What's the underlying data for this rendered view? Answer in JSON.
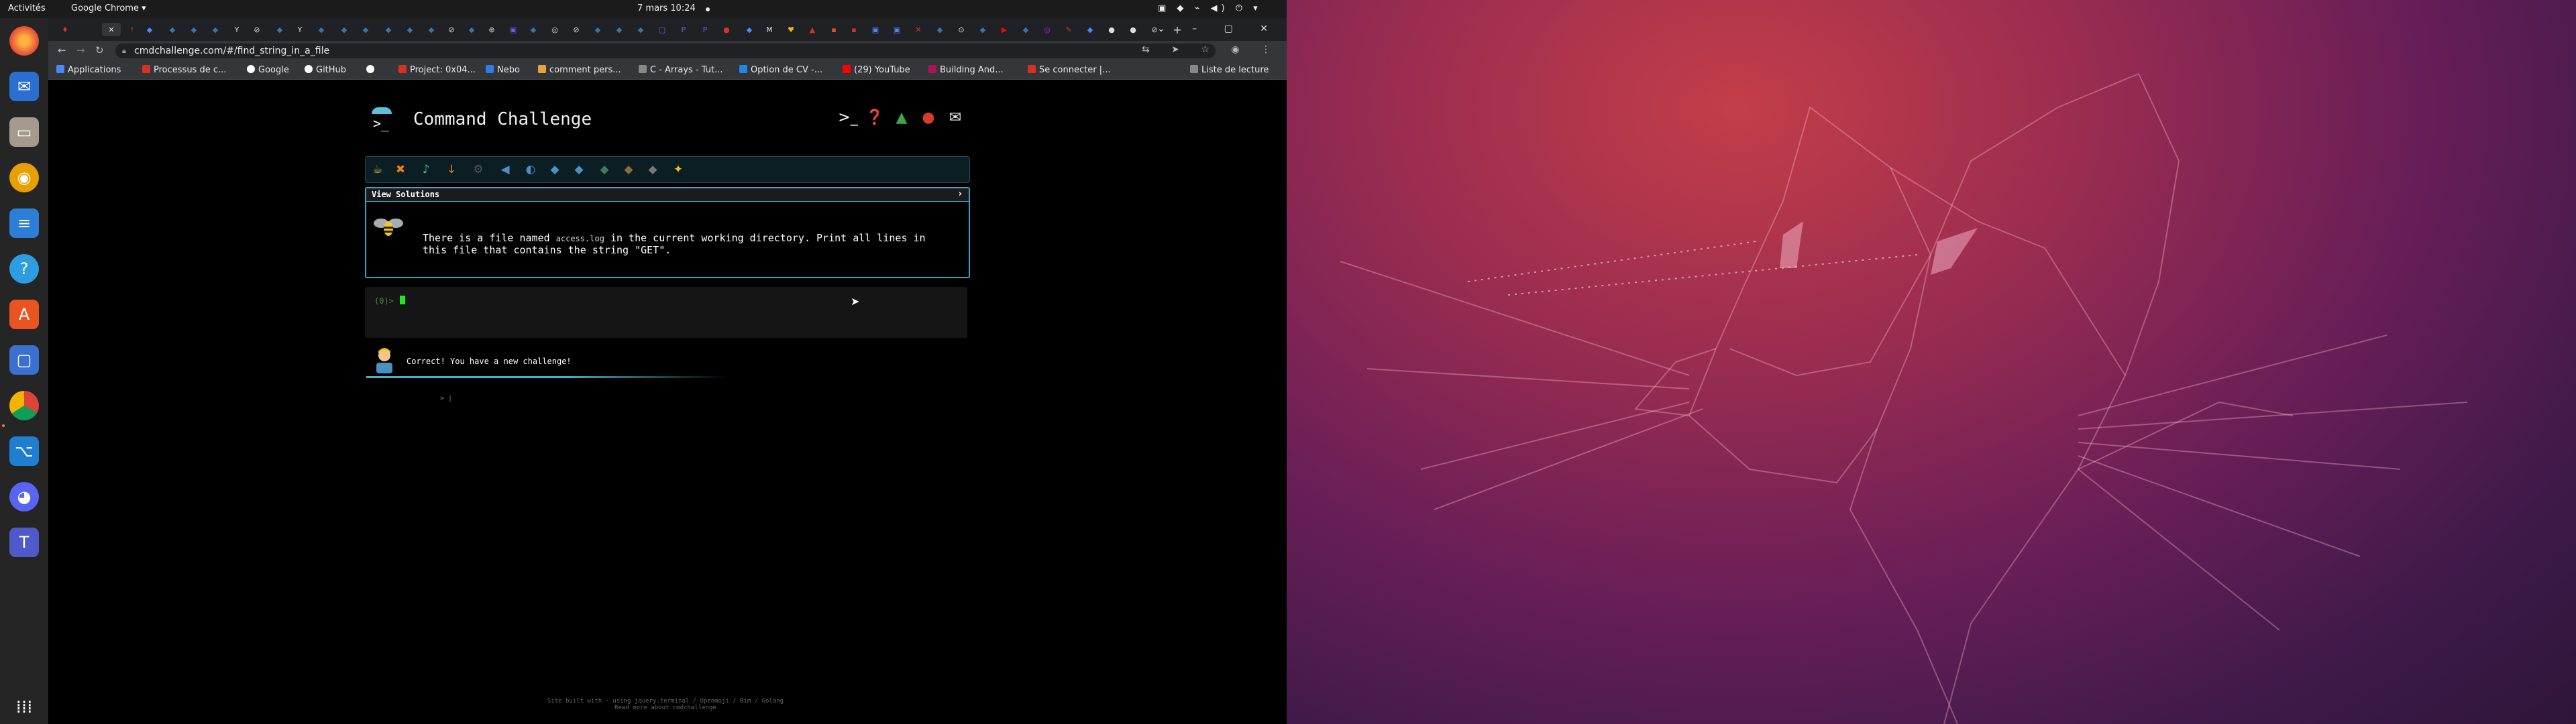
{
  "topbar": {
    "activities": "Activités",
    "app_menu": "Google Chrome ▾",
    "clock": "7 mars  10:24",
    "tray": "▣ ◆ ⌁ ◀) ⏻ ▾"
  },
  "dock": {
    "items": [
      "firefox",
      "thunderbird",
      "files",
      "rhythmbox",
      "writer",
      "help",
      "software",
      "screenshot",
      "chrome",
      "vscode",
      "discord",
      "teams",
      "apps-grid"
    ]
  },
  "browser": {
    "tabs_count": 34,
    "window_controls": "⌄ – ▢ ✕",
    "url": "cmdchallenge.com/#/find_string_in_a_file",
    "toolbar_right": "⇆ ➤ ☆ ◉ ⋮",
    "bookmarks": [
      {
        "label": "Applications",
        "color": "#4a8af4"
      },
      {
        "label": "Processus de c...",
        "color": "#d93025"
      },
      {
        "label": "Google",
        "color": "#ffffff"
      },
      {
        "label": "GitHub",
        "color": "#ffffff"
      },
      {
        "label": "",
        "color": "#ffffff"
      },
      {
        "label": "Project: 0x04...",
        "color": "#d93025"
      },
      {
        "label": "Nebo",
        "color": "#2b7de9"
      },
      {
        "label": "comment pers...",
        "color": "#e8a33c"
      },
      {
        "label": "C - Arrays - Tut...",
        "color": "#888888"
      },
      {
        "label": "Option de CV -...",
        "color": "#1e88e5"
      },
      {
        "label": "(29) YouTube",
        "color": "#ff0000"
      },
      {
        "label": "Building And...",
        "color": "#ad1457"
      },
      {
        "label": "Se connecter |...",
        "color": "#d93025"
      },
      {
        "label": "Liste de lecture",
        "color": "#888888"
      }
    ]
  },
  "page": {
    "title": "Command Challenge",
    "view_solutions": "View Solutions",
    "chevron": "›",
    "challenge_text_1": "There is a file named ",
    "challenge_code": "access.log",
    "challenge_text_2": " in the current working directory. Print all lines in this file that contains the string \"GET\".",
    "prompt": "(0)>",
    "guide_message": "Correct! You have a new challenge!",
    "small_prompt": "> |",
    "footer_line1": "Site built with · using jquery.terminal / Openmoji / Bim / Golang",
    "footer_line2": "Read more about cmdchallenge"
  },
  "colors": {
    "accent": "#3f9fc2",
    "prompt_green": "#3a8f3a",
    "cursor_green": "#22e622"
  }
}
